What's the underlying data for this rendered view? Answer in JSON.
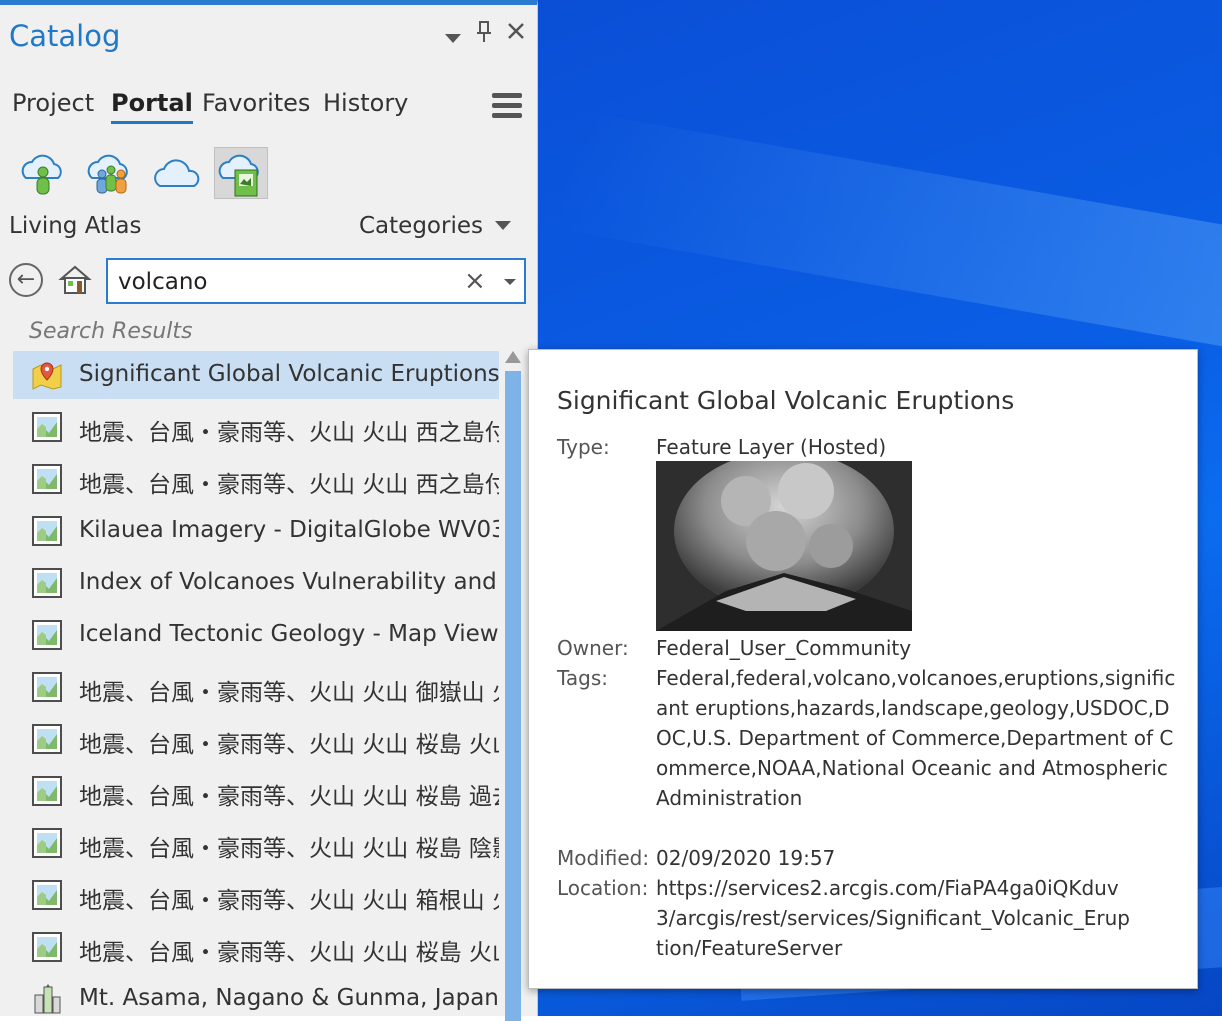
{
  "pane": {
    "title": "Catalog",
    "tabs": [
      "Project",
      "Portal",
      "Favorites",
      "History"
    ],
    "active_tab": "Portal",
    "source_label": "Living Atlas",
    "categories_label": "Categories",
    "search": {
      "value": "volcano"
    },
    "results_label": "Search Results",
    "results": [
      {
        "label": "Significant Global Volcanic Eruptions",
        "icon": "feature-layer-icon",
        "selected": true
      },
      {
        "label": "地震、台風・豪雨等、火山 火山 西之島付",
        "icon": "map-image-layer-icon"
      },
      {
        "label": "地震、台風・豪雨等、火山 火山 西之島付",
        "icon": "map-image-layer-icon"
      },
      {
        "label": "Kilauea Imagery - DigitalGlobe WV03",
        "icon": "map-image-layer-icon"
      },
      {
        "label": "Index of Volcanoes Vulnerability and Th",
        "icon": "map-image-layer-icon"
      },
      {
        "label": "Iceland Tectonic Geology - Map View",
        "icon": "map-image-layer-icon"
      },
      {
        "label": "地震、台風・豪雨等、火山 火山 御嶽山 火",
        "icon": "map-image-layer-icon"
      },
      {
        "label": "地震、台風・豪雨等、火山 火山 桜島 火山",
        "icon": "map-image-layer-icon"
      },
      {
        "label": "地震、台風・豪雨等、火山 火山 桜島 過去",
        "icon": "map-image-layer-icon"
      },
      {
        "label": "地震、台風・豪雨等、火山 火山 桜島 陰影",
        "icon": "map-image-layer-icon"
      },
      {
        "label": "地震、台風・豪雨等、火山 火山 箱根山 火",
        "icon": "map-image-layer-icon"
      },
      {
        "label": "地震、台風・豪雨等、火山 火山 桜島 火山",
        "icon": "map-image-layer-icon"
      },
      {
        "label": "Mt. Asama, Nagano & Gunma, Japan",
        "icon": "scene-layer-icon"
      }
    ]
  },
  "popup": {
    "title": "Significant Global Volcanic Eruptions",
    "type_label": "Type:",
    "type_value": "Feature Layer (Hosted)",
    "owner_label": "Owner:",
    "owner_value": "Federal_User_Community",
    "tags_label": "Tags:",
    "tags_value": "Federal,federal,volcano,volcanoes,eruptions,significant eruptions,hazards,landscape,geology,USDOC,DOC,U.S. Department of Commerce,Department of Commerce,NOAA,National Oceanic and Atmospheric Administration",
    "modified_label": "Modified:",
    "modified_value": "02/09/2020 19:57",
    "location_label": "Location:",
    "location_value": "https://services2.arcgis.com/FiaPA4ga0iQKduv3/arcgis/rest/services/Significant_Volcanic_Eruption/FeatureServer"
  },
  "colors": {
    "accent": "#1f78c8",
    "selection": "#c9def2",
    "desktop": "#0a5fe6"
  }
}
